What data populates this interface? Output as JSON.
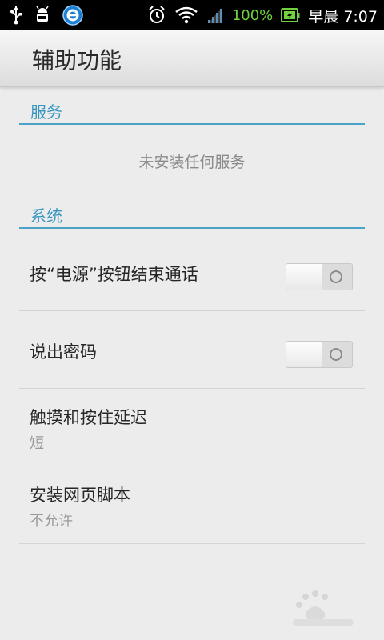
{
  "status_bar": {
    "battery_percent": "100%",
    "time": "早晨 7:07"
  },
  "header": {
    "title": "辅助功能"
  },
  "sections": {
    "services": {
      "label": "服务",
      "empty_text": "未安装任何服务"
    },
    "system": {
      "label": "系统",
      "items": [
        {
          "title": "按“电源”按钮结束通话",
          "toggle_on": false
        },
        {
          "title": "说出密码",
          "toggle_on": false
        },
        {
          "title": "触摸和按住延迟",
          "summary": "短"
        },
        {
          "title": "安装网页脚本",
          "summary": "不允许"
        }
      ]
    }
  },
  "colors": {
    "accent": "#3896bf",
    "battery": "#6fd13f"
  }
}
